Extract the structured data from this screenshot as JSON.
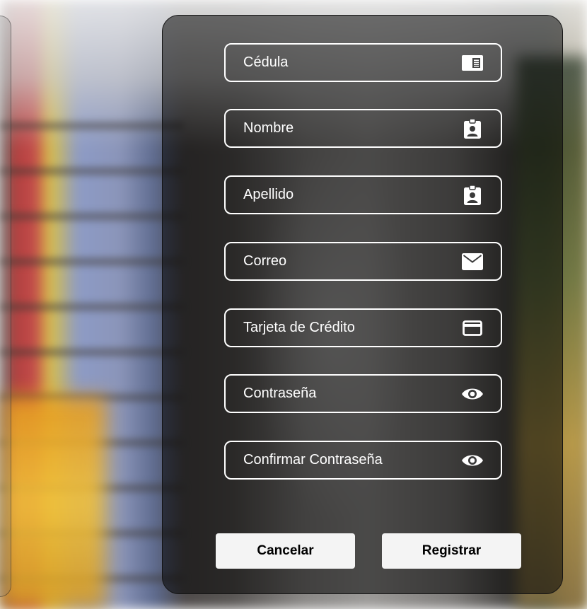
{
  "form": {
    "fields": [
      {
        "label": "Cédula",
        "icon": "id-card-icon"
      },
      {
        "label": "Nombre",
        "icon": "id-badge-icon"
      },
      {
        "label": "Apellido",
        "icon": "id-badge-icon"
      },
      {
        "label": "Correo",
        "icon": "envelope-icon"
      },
      {
        "label": "Tarjeta de Crédito",
        "icon": "credit-card-icon"
      },
      {
        "label": "Contraseña",
        "icon": "eye-icon"
      },
      {
        "label": "Confirmar Contraseña",
        "icon": "eye-icon"
      }
    ],
    "buttons": {
      "cancel_label": "Cancelar",
      "submit_label": "Registrar"
    }
  },
  "colors": {
    "field_border": "#ffffff",
    "text": "#ffffff",
    "button_bg": "#f4f4f4",
    "card_overlay": "rgba(0,0,0,0.52)"
  }
}
